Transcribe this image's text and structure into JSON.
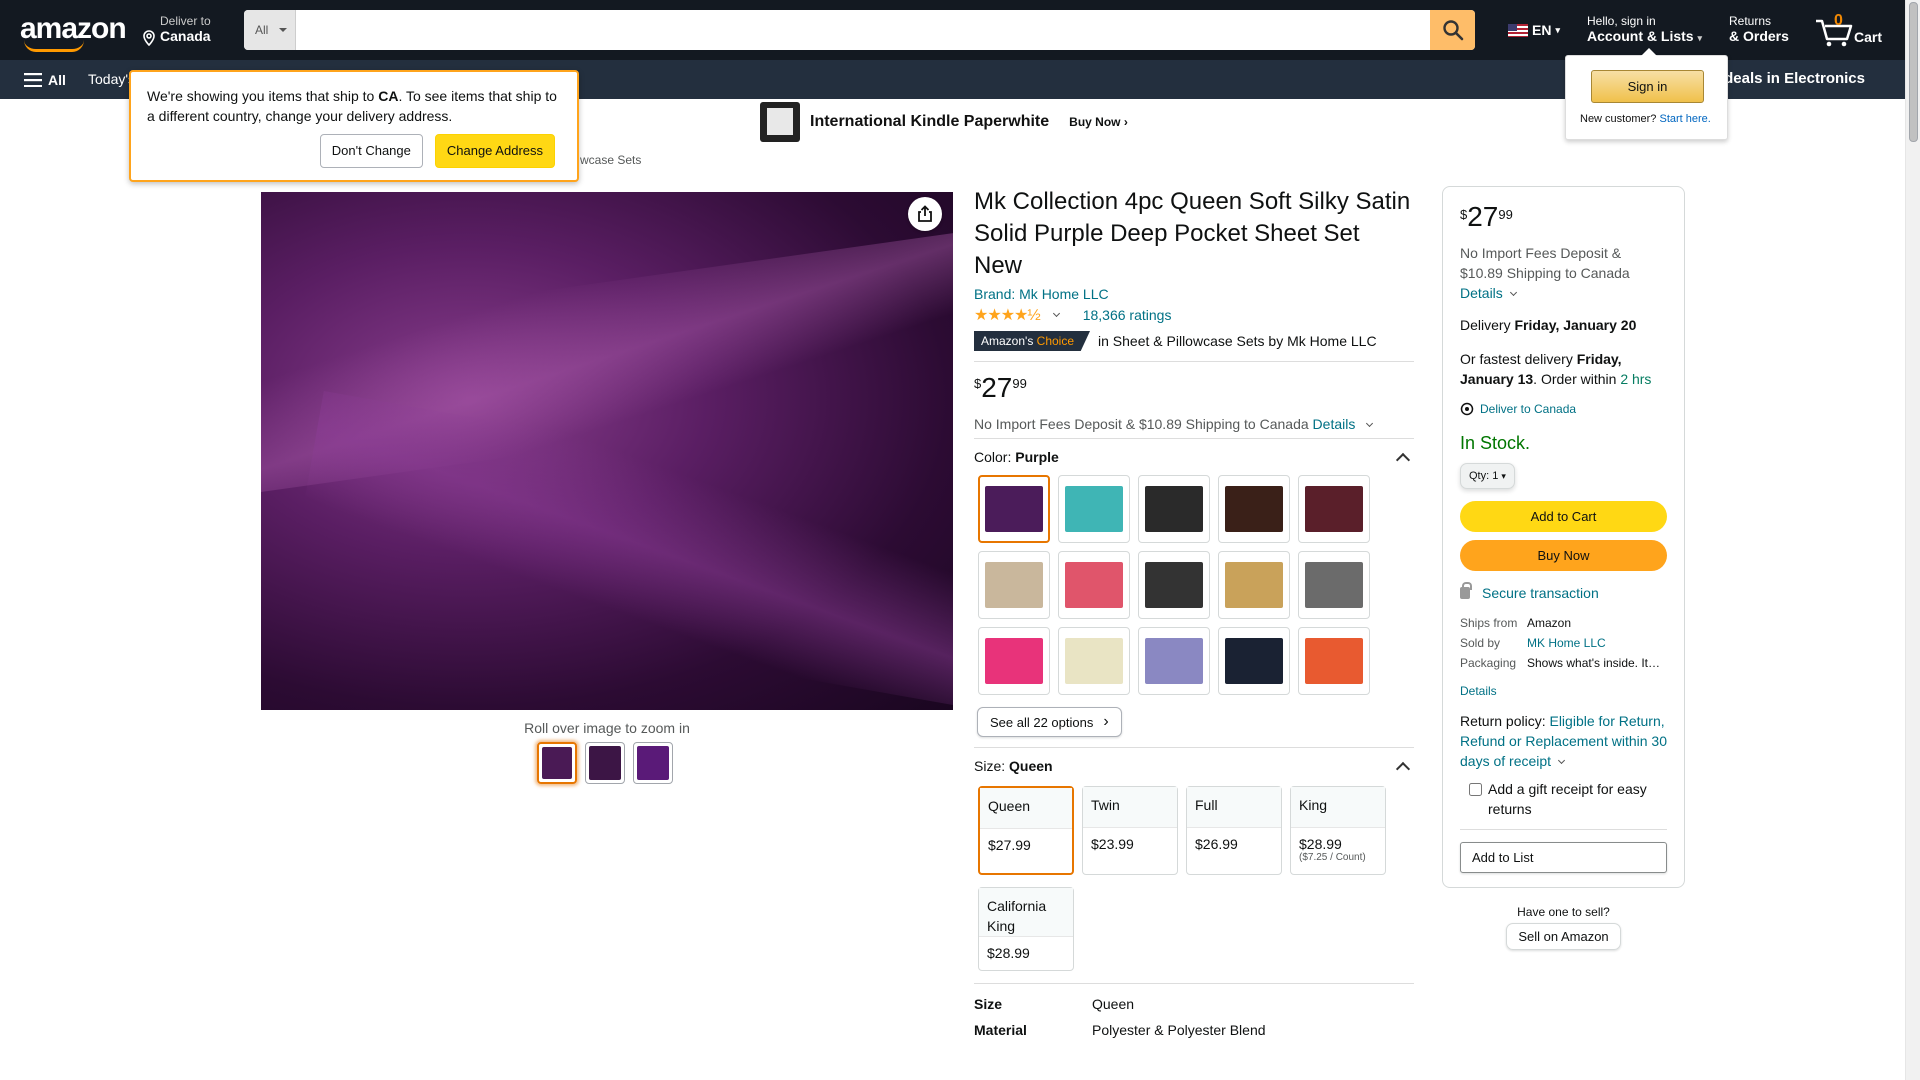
{
  "header": {
    "logo": "amazon",
    "deliver_label": "Deliver to",
    "deliver_location": "Canada",
    "search_category": "All",
    "search_placeholder": "",
    "language": "EN",
    "account_greeting": "Hello, sign in",
    "account_label": "Account & Lists",
    "returns_label": "Returns",
    "orders_label": "& Orders",
    "cart_count": "0",
    "cart_label": "Cart"
  },
  "subnav": {
    "all_label": "All",
    "todays": "Today's",
    "right_promo": "op deals in Electronics"
  },
  "banner": {
    "title": "International Kindle Paperwhite",
    "cta": "Buy Now ›"
  },
  "breadcrumb": "wcase Sets",
  "ship_popover": {
    "text_1": "We're showing you items that ship to ",
    "country": "CA",
    "text_2": ". To see items that ship to a different country, change your delivery address.",
    "dont_change": "Don't Change",
    "change_address": "Change Address"
  },
  "signin_popover": {
    "button": "Sign in",
    "new_customer": "New customer?",
    "start_here": "Start here."
  },
  "gallery": {
    "zoom_hint": "Roll over image to zoom in",
    "thumb_colors": [
      "#4a1a55",
      "#3c1545",
      "#5a1a78"
    ]
  },
  "product": {
    "title": "Mk Collection 4pc Queen Soft Silky Satin Solid Purple Deep Pocket Sheet Set New",
    "brand": "Brand: Mk Home LLC",
    "stars": "★★★★½",
    "rating_value": 4.5,
    "ratings": "18,366 ratings",
    "choice_label_1": "Amazon's",
    "choice_label_2": "Choice",
    "choice_category": "in Sheet & Pillowcase Sets by Mk Home LLC",
    "price_symbol": "$",
    "price_whole": "27",
    "price_fraction": "99",
    "fees": "No Import Fees Deposit & $10.89 Shipping to Canada",
    "details_link": "Details",
    "color_label": "Color:",
    "color_value": "Purple",
    "swatch_colors": [
      "#4b1c5a",
      "#3fb5b5",
      "#2a2a2a",
      "#3a2018",
      "#5a1f2a",
      "#c9b79c",
      "#e0556b",
      "#333333",
      "#c9a25a",
      "#6b6b6b",
      "#e8337a",
      "#e9e4c4",
      "#8a88c2",
      "#1a2233",
      "#e85a30"
    ],
    "see_all": "See all 22 options",
    "size_label": "Size:",
    "size_value": "Queen",
    "sizes": [
      {
        "name": "Queen",
        "price": "$27.99",
        "unit": ""
      },
      {
        "name": "Twin",
        "price": "$23.99",
        "unit": ""
      },
      {
        "name": "Full",
        "price": "$26.99",
        "unit": ""
      },
      {
        "name": "King",
        "price": "$28.99",
        "unit": "($7.25 / Count)"
      },
      {
        "name": "California King",
        "price": "$28.99",
        "unit": ""
      }
    ],
    "specs": [
      {
        "k": "Size",
        "v": "Queen"
      },
      {
        "k": "Material",
        "v": "Polyester & Polyester Blend"
      }
    ]
  },
  "buybox": {
    "price_symbol": "$",
    "price_whole": "27",
    "price_fraction": "99",
    "fees": "No Import Fees Deposit & $10.89 Shipping to Canada",
    "details": "Details",
    "delivery_prefix": "Delivery ",
    "delivery_date": "Friday, January 20",
    "fastest_prefix": "Or fastest delivery ",
    "fastest_date": "Friday, January 13",
    "order_within": ". Order within ",
    "order_time": "2 hrs",
    "deliver_to": "Deliver to Canada",
    "stock": "In Stock.",
    "qty": "Qty: 1",
    "add_to_cart": "Add to Cart",
    "buy_now": "Buy Now",
    "secure": "Secure transaction",
    "ships_from_k": "Ships from",
    "ships_from_v": "Amazon",
    "sold_by_k": "Sold by",
    "sold_by_v": "MK Home LLC",
    "packaging_k": "Packaging",
    "packaging_v": "Shows what's inside. It…",
    "details_2": "Details",
    "return_prefix": "Return policy: ",
    "return_link": "Eligible for Return, Refund or Replacement within 30 days of receipt",
    "gift": "Add a gift receipt for easy returns",
    "add_to_list": "Add to List"
  },
  "sell": {
    "question": "Have one to sell?",
    "button": "Sell on Amazon"
  }
}
